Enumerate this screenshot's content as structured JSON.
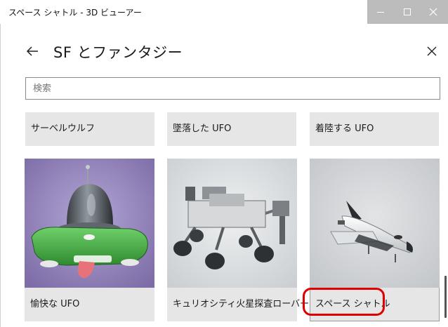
{
  "window": {
    "title": "スペース シャトル - 3D ビューアー",
    "chrome_color": "#bcbcbc"
  },
  "panel": {
    "title": "SF とファンタジー",
    "back_icon": "arrow-left-icon",
    "close_icon": "close-icon"
  },
  "search": {
    "placeholder": "検索",
    "value": ""
  },
  "top_row": [
    {
      "label": "サーベルウルフ"
    },
    {
      "label": "墜落した UFO"
    },
    {
      "label": "着陸する UFO"
    }
  ],
  "cards": [
    {
      "label": "愉快な UFO",
      "thumbnail": "ufo-character-thumbnail",
      "bg": "#9c8cc2"
    },
    {
      "label": "キュリオシティ火星探査ローバー",
      "thumbnail": "mars-rover-thumbnail",
      "bg": "#d9dcde"
    },
    {
      "label": "スペース シャトル",
      "thumbnail": "space-shuttle-thumbnail",
      "bg": "#d2d4d6",
      "selected": true
    }
  ],
  "highlight_color": "#e00000"
}
